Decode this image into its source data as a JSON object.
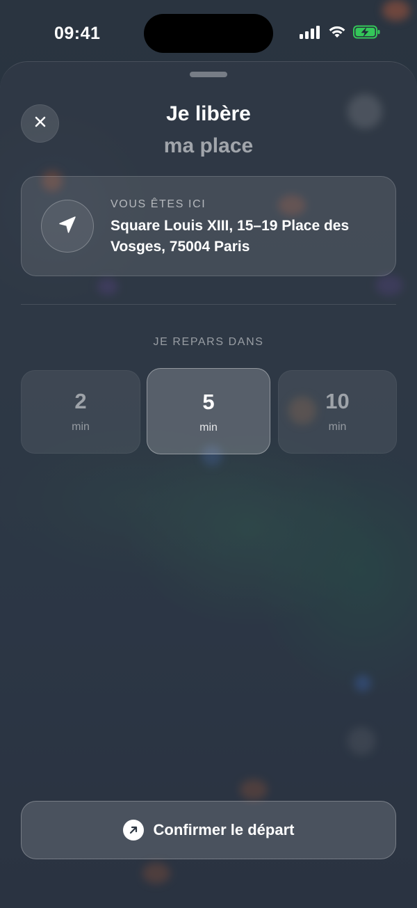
{
  "status_bar": {
    "time": "09:41",
    "icons": [
      "signal-icon",
      "wifi-icon",
      "battery-charging-icon"
    ],
    "battery_color": "#34c759"
  },
  "sheet": {
    "title": "Je libère",
    "subtitle": "ma place",
    "close_icon": "close-icon"
  },
  "location": {
    "label": "VOUS ÊTES ICI",
    "address": "Square Louis XIII, 15–19 Place des Vosges, 75004 Paris",
    "icon": "location-arrow-icon"
  },
  "departure": {
    "label": "JE REPARS DANS",
    "options": [
      {
        "value": "2",
        "unit": "min",
        "selected": false
      },
      {
        "value": "5",
        "unit": "min",
        "selected": true
      },
      {
        "value": "10",
        "unit": "min",
        "selected": false
      }
    ]
  },
  "confirm": {
    "label": "Confirmer le départ",
    "icon": "arrow-up-right-icon"
  }
}
